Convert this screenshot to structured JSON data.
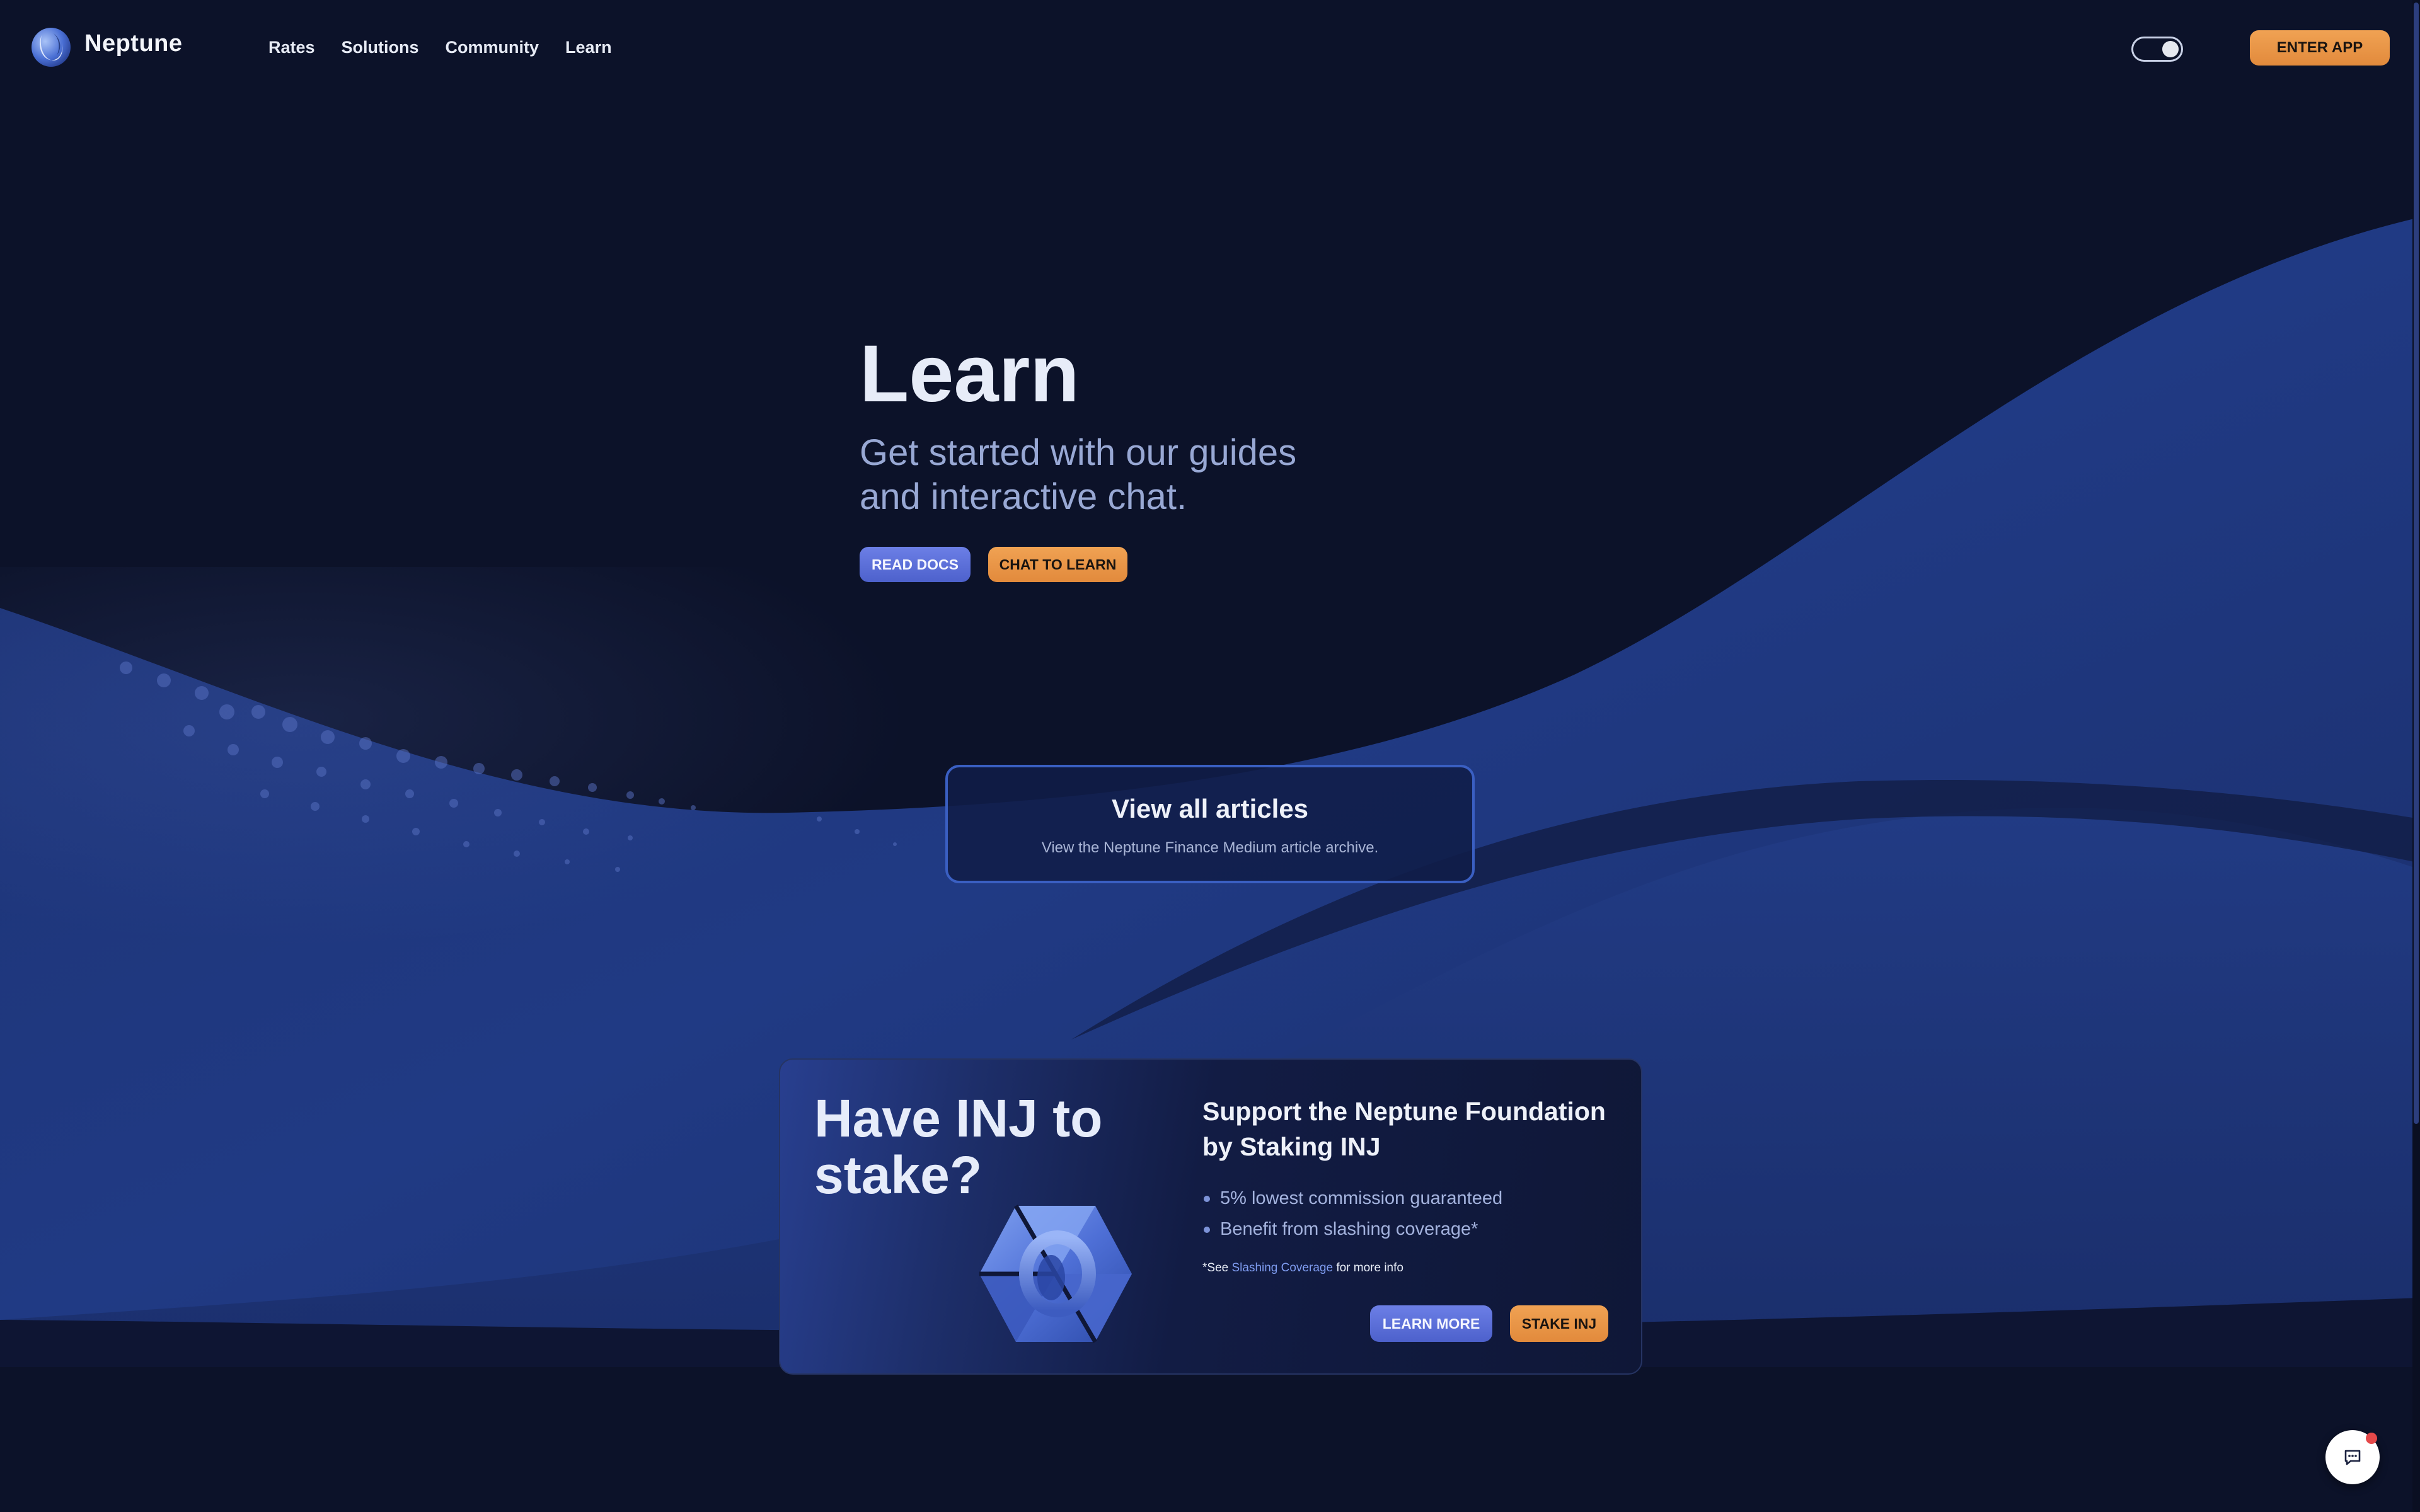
{
  "header": {
    "brand": "Neptune",
    "nav": [
      "Rates",
      "Solutions",
      "Community",
      "Learn"
    ],
    "enter_app": "ENTER APP",
    "theme_toggle_on": true
  },
  "hero": {
    "title": "Learn",
    "subtitle": "Get started with our guides and interactive chat.",
    "read_docs": "READ DOCS",
    "chat_to_learn": "CHAT TO LEARN"
  },
  "articles": {
    "title": "View all articles",
    "description": "View the Neptune Finance Medium article archive."
  },
  "stake": {
    "title": "Have INJ to stake?",
    "support_title": "Support the Neptune Foundation by Staking INJ",
    "bullets": [
      "5% lowest commission guaranteed",
      "Benefit from slashing coverage*"
    ],
    "footnote_prefix": "*See",
    "footnote_link": "Slashing Coverage",
    "footnote_suffix": "for more info",
    "learn_more": "LEARN MORE",
    "stake_inj": "STAKE INJ"
  },
  "colors": {
    "background": "#0c1229",
    "accent_orange": "#e8943f",
    "accent_blue": "#5a6ed8",
    "wave": "#1e3576",
    "notification_dot": "#e5494a"
  },
  "icons": [
    "neptune-logo-icon",
    "injective-logo-icon",
    "chat-icon"
  ]
}
